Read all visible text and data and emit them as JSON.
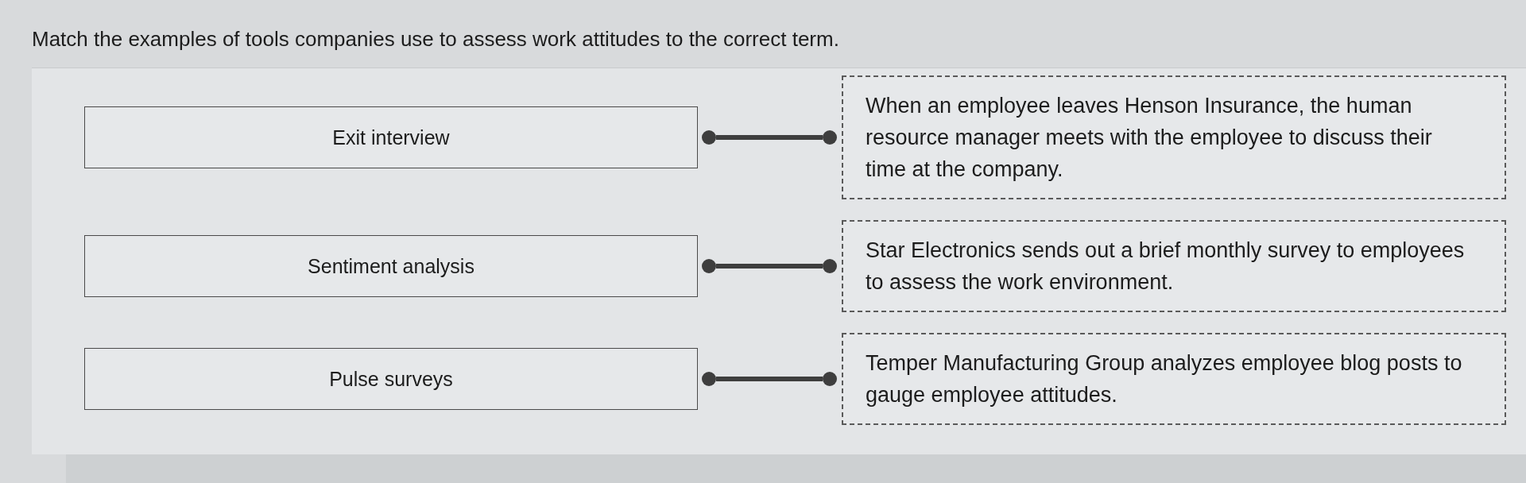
{
  "question": {
    "prompt": "Match the examples of tools companies use to assess work attitudes to the correct term."
  },
  "pairs": [
    {
      "term": "Exit interview",
      "example": "When an employee leaves Henson Insurance, the human resource manager meets with the employee to discuss their time at the company.",
      "connected": true
    },
    {
      "term": "Sentiment analysis",
      "example": "Star Electronics sends out a brief monthly survey to employees to assess the work environment.",
      "connected": true
    },
    {
      "term": "Pulse surveys",
      "example": "Temper Manufacturing Group analyzes employee blog posts to gauge employee attitudes.",
      "connected": true
    }
  ]
}
